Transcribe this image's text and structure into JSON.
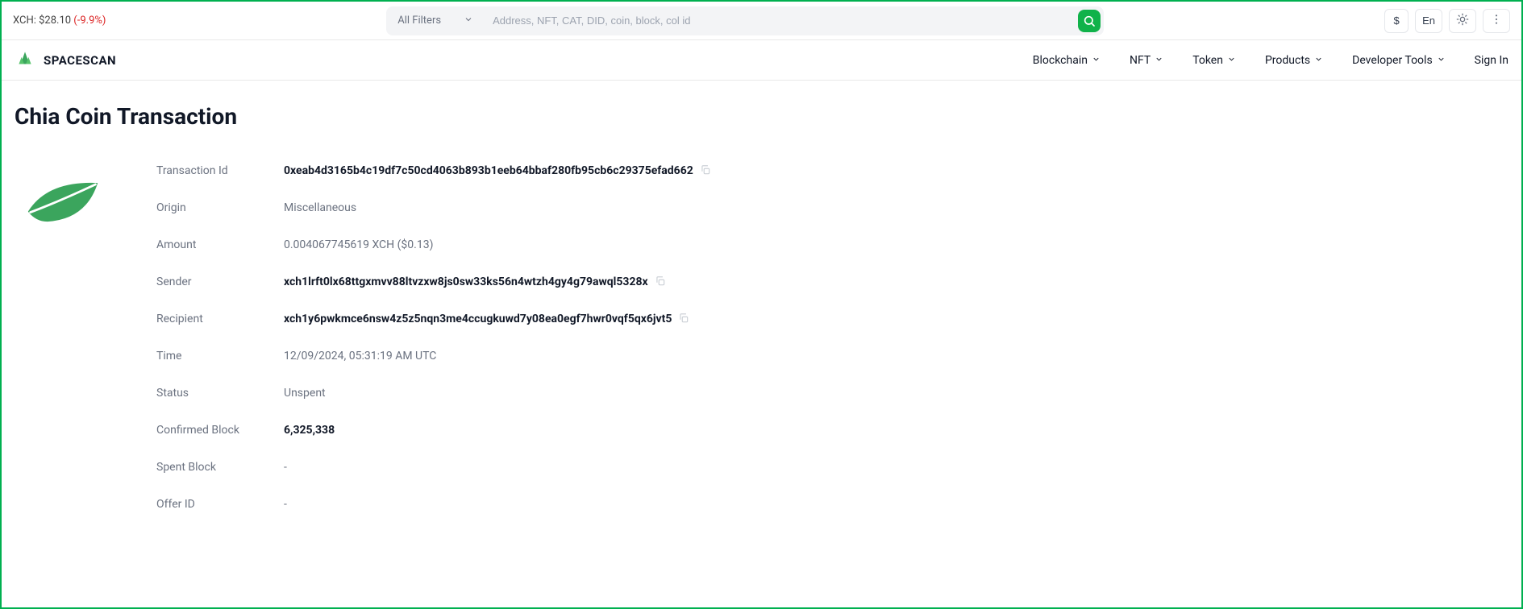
{
  "top": {
    "price_label": "XCH: $28.10 ",
    "price_change": "(-9.9%)"
  },
  "search": {
    "filter_label": "All Filters",
    "placeholder": "Address, NFT, CAT, DID, coin, block, col id"
  },
  "controls": {
    "currency": "$",
    "lang": "En"
  },
  "nav": {
    "brand": "SPACESCAN",
    "items": [
      "Blockchain",
      "NFT",
      "Token",
      "Products",
      "Developer Tools"
    ],
    "signin": "Sign In"
  },
  "page": {
    "title": "Chia Coin Transaction"
  },
  "tx": {
    "labels": {
      "id": "Transaction Id",
      "origin": "Origin",
      "amount": "Amount",
      "sender": "Sender",
      "recipient": "Recipient",
      "time": "Time",
      "status": "Status",
      "confirmed_block": "Confirmed Block",
      "spent_block": "Spent Block",
      "offer_id": "Offer ID"
    },
    "values": {
      "id": "0xeab4d3165b4c19df7c50cd4063b893b1eeb64bbaf280fb95cb6c29375efad662",
      "origin": "Miscellaneous",
      "amount": "0.004067745619 XCH ($0.13)",
      "sender": "xch1lrft0lx68ttgxmvv88ltvzxw8js0sw33ks56n4wtzh4gy4g79awql5328x",
      "recipient": "xch1y6pwkmce6nsw4z5z5nqn3me4ccugkuwd7y08ea0egf7hwr0vqf5qx6jvt5",
      "time": "12/09/2024, 05:31:19 AM UTC",
      "status": "Unspent",
      "confirmed_block": "6,325,338",
      "spent_block": "-",
      "offer_id": "-"
    }
  }
}
